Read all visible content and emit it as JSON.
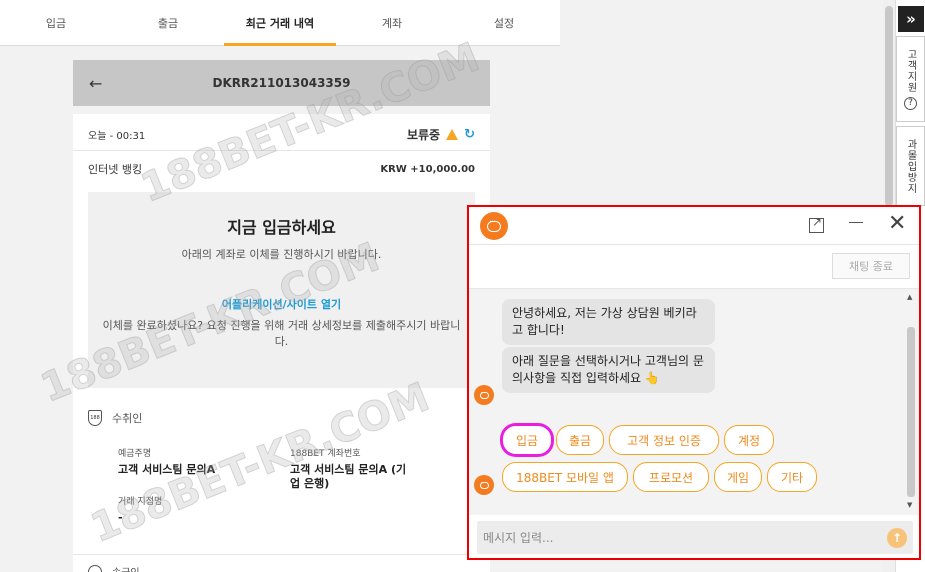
{
  "nav": {
    "tabs": [
      "입금",
      "출금",
      "최근 거래 내역",
      "계좌",
      "설정"
    ],
    "active_index": 2
  },
  "sidebar": {
    "top_icon": "»",
    "support_label": "고객지원",
    "gambling_label": "과몰입방지"
  },
  "transaction": {
    "id": "DKRR211013043359",
    "time": "오늘 - 00:31",
    "status": "보류중",
    "method": "인터넷 뱅킹",
    "amount": "KRW +10,000.00",
    "deposit_title": "지금 입금하세요",
    "deposit_desc": "아래의 계좌로 이체를 진행하시기 바랍니다.",
    "open_app_link": "어플리케이션/사이트 열기",
    "completion_desc": "이체를 완료하셨나요? 요청 진행을 위해 거래 상세정보를 제출해주시기 바랍니다.",
    "recipient_label": "수취인",
    "recipient_badge": "188",
    "depositor_label": "예금주명",
    "depositor_value": "고객 서비스팀 문의A",
    "account_label": "188BET 계좌번호",
    "account_value": "고객 서비스팀 문의A (기업 은행)",
    "branch_label": "거래 지점명",
    "branch_value": "-",
    "next_section": "송금인"
  },
  "chat": {
    "end_button": "채팅 종료",
    "messages": [
      "안녕하세요, 저는 가상 상담원 베키라고 합니다!",
      "아래 질문을 선택하시거나 고객님의 문의사항을 직접 입력하세요 👆"
    ],
    "options_row1": [
      "입금",
      "출금",
      "고객 정보 인증",
      "계정"
    ],
    "options_row2": [
      "188BET 모바일 앱",
      "프로모션",
      "게임",
      "기타"
    ],
    "highlighted_option": "입금",
    "input_placeholder": "메시지 입력...",
    "accent_color": "#f47b20"
  },
  "watermark": "188BET-KR.COM",
  "colors": {
    "tab_underline": "#f5a623",
    "link": "#1e9bd7",
    "highlight_border": "#e00000"
  }
}
